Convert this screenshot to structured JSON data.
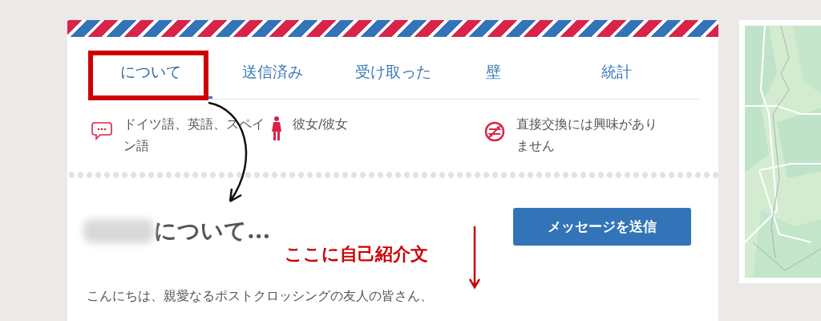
{
  "tabs": [
    {
      "label": "について",
      "selected": true
    },
    {
      "label": "送信済み",
      "selected": false
    },
    {
      "label": "受け取った",
      "selected": false
    },
    {
      "label": "壁",
      "selected": false
    },
    {
      "label": "統計",
      "selected": false
    }
  ],
  "info": [
    {
      "kind": "languages",
      "text": "ドイツ語、英語、スペイン語"
    },
    {
      "kind": "gender",
      "text": "彼女/彼女"
    },
    {
      "kind": "no-swap",
      "text": "直接交換には興味がありません"
    }
  ],
  "about": {
    "heading": "について...",
    "button": "メッセージを送信",
    "intro": "こんにちは、親愛なるポストクロッシングの友人の皆さん、"
  },
  "annotation": {
    "text": "ここに自己紹介文"
  }
}
